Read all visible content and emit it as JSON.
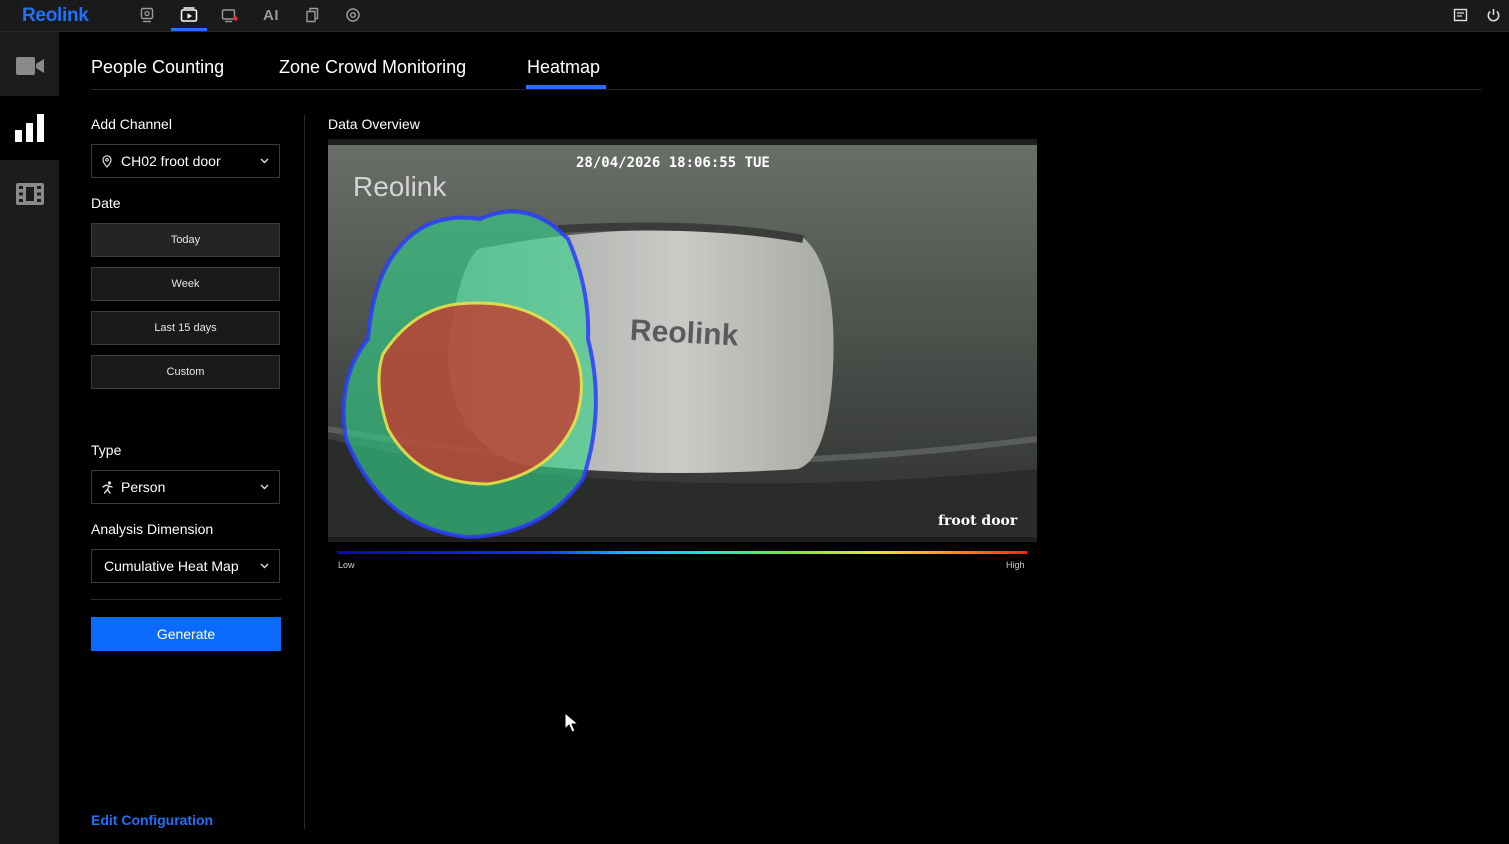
{
  "app": {
    "logo": "Reolink"
  },
  "topnav": {
    "ai_label": "AI",
    "items": [
      "live-view",
      "playback",
      "alerts",
      "ai",
      "files",
      "settings"
    ],
    "active": "playback"
  },
  "rail": {
    "items": [
      "camera",
      "analytics",
      "filmstrip"
    ],
    "active": "analytics"
  },
  "tabs": [
    {
      "label": "People Counting"
    },
    {
      "label": "Zone Crowd Monitoring"
    },
    {
      "label": "Heatmap"
    }
  ],
  "active_tab": "Heatmap",
  "filters": {
    "channel_label": "Add Channel",
    "channel_value": "CH02 froot door",
    "date_label": "Date",
    "date_options": [
      "Today",
      "Week",
      "Last 15 days",
      "Custom"
    ],
    "type_label": "Type",
    "type_value": "Person",
    "dimension_label": "Analysis Dimension",
    "dimension_value": "Cumulative Heat Map",
    "generate_label": "Generate",
    "edit_config_label": "Edit Configuration"
  },
  "overview": {
    "title": "Data Overview",
    "camera": {
      "timestamp": "28/04/2026 18:06:55 TUE",
      "watermark": "Reolink",
      "device_logo": "Reolink",
      "channel_name": "froot door"
    },
    "legend": {
      "low": "Low",
      "high": "High"
    }
  },
  "colors": {
    "accent": "#1e72ff",
    "button": "#0b6bff",
    "heat_high": "#c83a30",
    "heat_mid": "#2ecc7a",
    "heat_edge": "#2a3cff"
  }
}
